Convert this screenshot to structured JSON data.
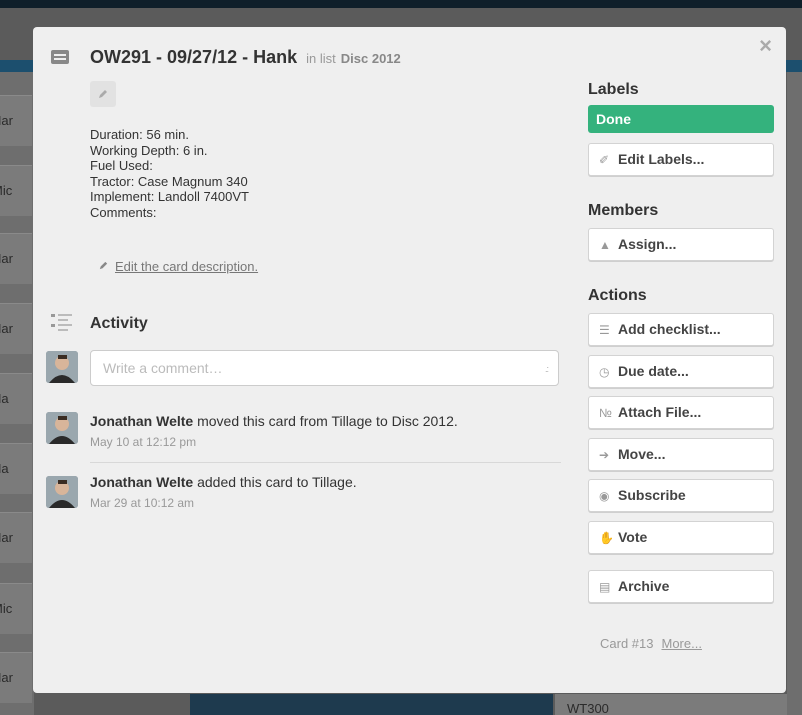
{
  "background": {
    "left_card_labels": [
      "Har",
      "Mic",
      "Har",
      "Har",
      "Ha",
      "Ha",
      "Har",
      "Mic",
      "Har"
    ],
    "bottom_right_card": "WT300"
  },
  "card": {
    "title": "OW291 - 09/27/12 - Hank",
    "in_list_prefix": "in list",
    "list_name": "Disc 2012",
    "description_lines": [
      "Duration: 56 min.",
      "Working Depth: 6 in.",
      "Fuel Used:",
      "Tractor: Case Magnum 340",
      "Implement: Landoll 7400VT",
      "Comments:"
    ],
    "edit_description_link": "Edit the card description.",
    "close_symbol": "×"
  },
  "activity": {
    "title": "Activity",
    "comment_placeholder": "Write a comment…",
    "items": [
      {
        "who": "Jonathan Welte",
        "action": "moved this card from Tillage to Disc 2012.",
        "time": "May 10 at 12:12 pm"
      },
      {
        "who": "Jonathan Welte",
        "action": "added this card to Tillage.",
        "time": "Mar 29 at 10:12 am"
      }
    ]
  },
  "sidebar": {
    "labels_heading": "Labels",
    "label_done": "Done",
    "label_done_color": "#34b27d",
    "edit_labels": "Edit Labels...",
    "members_heading": "Members",
    "assign": "Assign...",
    "actions_heading": "Actions",
    "actions": {
      "add_checklist": "Add checklist...",
      "due_date": "Due date...",
      "attach_file": "Attach File...",
      "move": "Move...",
      "subscribe": "Subscribe",
      "vote": "Vote",
      "archive": "Archive"
    },
    "card_number": "Card #13",
    "more": "More..."
  }
}
